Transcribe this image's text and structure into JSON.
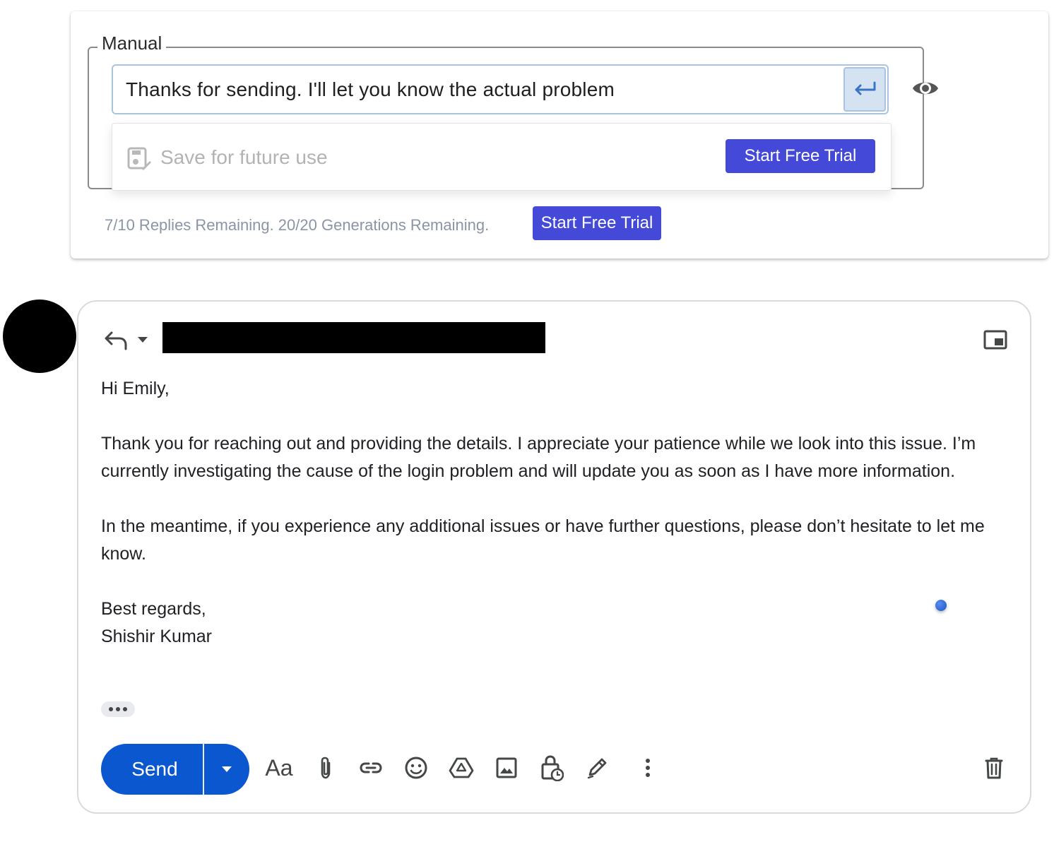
{
  "assistant_panel": {
    "legend": "Manual",
    "manual_input_value": "Thanks for sending. I'll let you know the actual problem",
    "save_label": "Save for future use",
    "trial_button_inner": "Start Free Trial",
    "remaining_text": "7/10 Replies Remaining. 20/20 Generations Remaining.",
    "trial_button_outer": "Start Free Trial",
    "accent_color": "#4449d8",
    "icons": [
      "enter-icon",
      "eye-icon",
      "save-template-icon"
    ]
  },
  "compose": {
    "greeting": "Hi Emily,",
    "paragraph1": "Thank you for reaching out and providing the details. I appreciate your patience while we look into this issue. I’m currently investigating the cause of the login problem and will update you as soon as I have more information.",
    "paragraph2": "In the meantime, if you experience any additional issues or have further questions, please don’t hesitate to let me know.",
    "signoff": "Best regards,",
    "signature": "Shishir Kumar",
    "send_label": "Send",
    "format_label": "Aa",
    "send_color": "#0b57d0",
    "icons": [
      "reply-icon",
      "reply-type-caret-icon",
      "popout-icon",
      "send-options-caret-icon",
      "attach-icon",
      "link-icon",
      "emoji-icon",
      "drive-icon",
      "photo-icon",
      "confidential-lock-icon",
      "signature-pen-icon",
      "more-options-icon",
      "trash-icon"
    ]
  }
}
